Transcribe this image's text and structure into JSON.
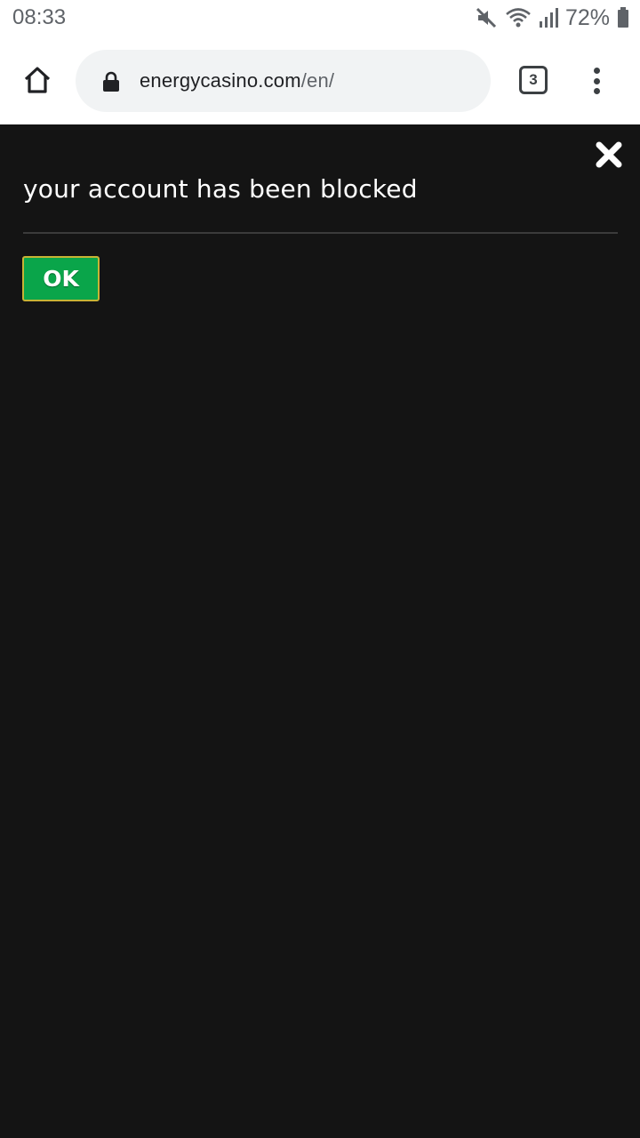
{
  "status_bar": {
    "time": "08:33",
    "battery_percent": "72%",
    "icons": [
      "mute-icon",
      "wifi-icon",
      "signal-icon",
      "battery-icon"
    ]
  },
  "browser": {
    "url_host": "energycasino.com",
    "url_path": "/en/",
    "tab_count": "3",
    "icons": [
      "home-icon",
      "lock-icon",
      "more-menu-icon"
    ]
  },
  "dialog": {
    "message": "your account has been blocked",
    "ok_label": "OK",
    "close_icon": "close-icon"
  },
  "colors": {
    "page_background": "#141414",
    "ok_button": "#0aa54a",
    "ok_button_border": "#c7b335",
    "text": "#ffffff"
  }
}
